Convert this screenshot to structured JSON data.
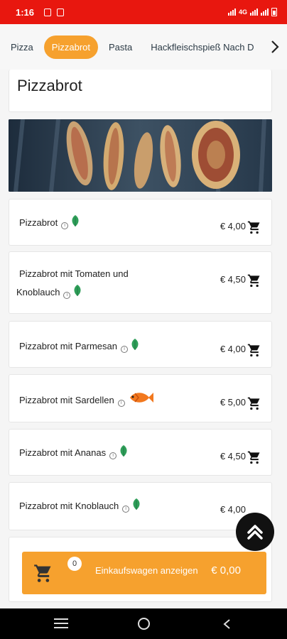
{
  "status": {
    "time": "1:16",
    "network": "4G"
  },
  "tabs": [
    {
      "label": "Pizza",
      "active": false
    },
    {
      "label": "Pizzabrot",
      "active": true
    },
    {
      "label": "Pasta",
      "active": false
    },
    {
      "label": "Hackfleischspieß Nach D",
      "active": false
    }
  ],
  "section": {
    "title": "Pizzabrot"
  },
  "items": [
    {
      "name": "Pizzabrot",
      "price": "€ 4,00",
      "icon": "leaf-icon"
    },
    {
      "name_line1": "Pizzabrot mit Tomaten und",
      "name_line2": "Knoblauch",
      "price": "€ 4,50",
      "icon": "leaf-icon"
    },
    {
      "name": "Pizzabrot mit Parmesan",
      "price": "€ 4,00",
      "icon": "leaf-icon"
    },
    {
      "name": "Pizzabrot mit Sardellen",
      "price": "€ 5,00",
      "icon": "fish-icon"
    },
    {
      "name": "Pizzabrot mit Ananas",
      "price": "€ 4,50",
      "icon": "leaf-icon"
    },
    {
      "name": "Pizzabrot mit Knoblauch",
      "price": "€ 4,00",
      "icon": "leaf-icon"
    }
  ],
  "cart": {
    "count": "0",
    "label": "Einkaufswagen anzeigen",
    "total": "€ 0,00"
  },
  "colors": {
    "status_bar": "#e8170f",
    "accent": "#f6a12e",
    "leaf": "#2f9e59",
    "fish": "#f2781e"
  }
}
